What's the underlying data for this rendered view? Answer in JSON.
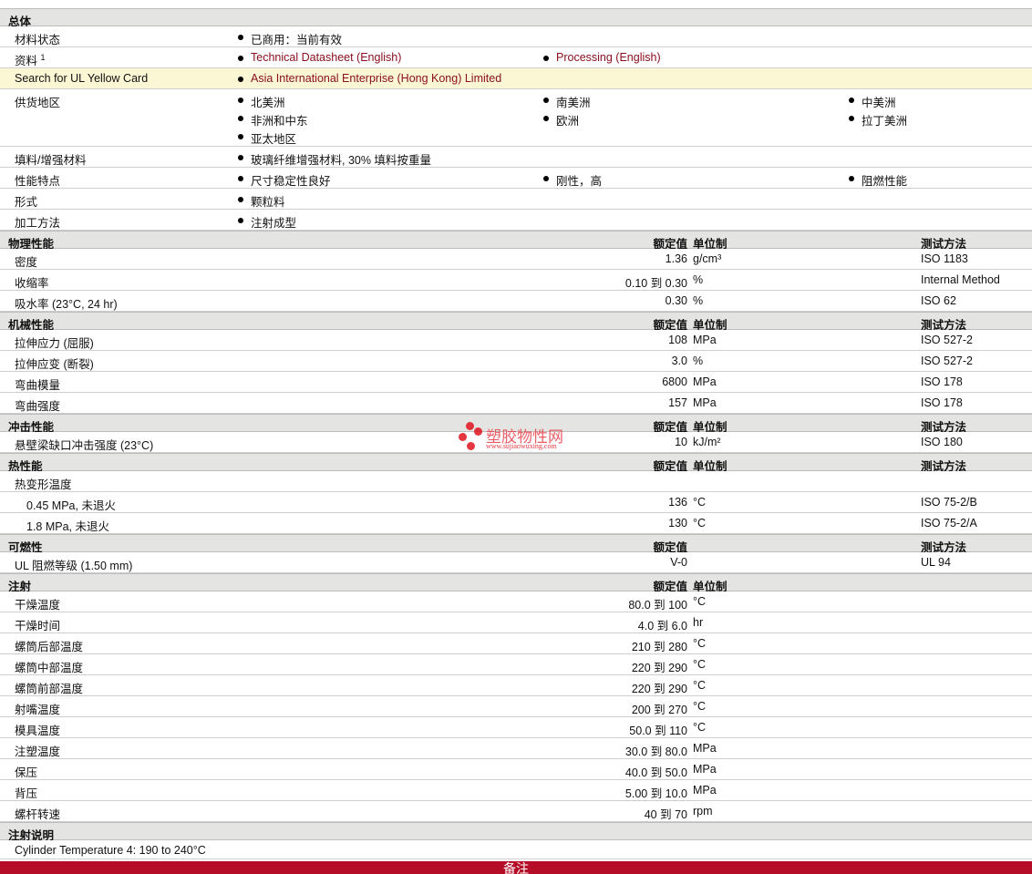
{
  "general": {
    "title": "总体",
    "rows": [
      {
        "label": "材料状态",
        "items": [
          {
            "text": "已商用：当前有效"
          }
        ]
      },
      {
        "label": "资料",
        "sup": "1",
        "items": [
          {
            "text": "Technical Datasheet (English)",
            "link": true
          },
          {
            "text": "Processing (English)",
            "link": true
          }
        ]
      },
      {
        "label": "Search for UL Yellow Card",
        "highlight": true,
        "items": [
          {
            "text": "Asia International Enterprise (Hong Kong) Limited",
            "link": true
          }
        ]
      },
      {
        "label": "供货地区",
        "items": [
          {
            "text": "北美洲"
          },
          {
            "text": "南美洲"
          },
          {
            "text": "中美洲"
          },
          {
            "text": "非洲和中东"
          },
          {
            "text": "欧洲"
          },
          {
            "text": "拉丁美洲"
          },
          {
            "text": "亚太地区"
          }
        ],
        "grid": true
      },
      {
        "label": "填料/增强材料",
        "items": [
          {
            "text": "玻璃纤维增强材料, 30% 填料按重量"
          }
        ]
      },
      {
        "label": "性能特点",
        "items": [
          {
            "text": "尺寸稳定性良好"
          },
          {
            "text": "刚性，高"
          },
          {
            "text": "阻燃性能"
          }
        ]
      },
      {
        "label": "形式",
        "items": [
          {
            "text": "颗粒料"
          }
        ]
      },
      {
        "label": "加工方法",
        "items": [
          {
            "text": "注射成型"
          }
        ]
      }
    ]
  },
  "sections": [
    {
      "title": "物理性能",
      "col_value": "额定值",
      "col_unit": "单位制",
      "col_test": "测试方法",
      "rows": [
        {
          "label": "密度",
          "value": "1.36",
          "unit": "g/cm³",
          "test": "ISO 1183"
        },
        {
          "label": "收缩率",
          "value": "0.10 到  0.30",
          "unit": "%",
          "test": "Internal Method"
        },
        {
          "label": "吸水率  (23°C, 24 hr)",
          "value": "0.30",
          "unit": "%",
          "test": "ISO 62"
        }
      ]
    },
    {
      "title": "机械性能",
      "col_value": "额定值",
      "col_unit": "单位制",
      "col_test": "测试方法",
      "rows": [
        {
          "label": "拉伸应力  (屈服)",
          "value": "108",
          "unit": "MPa",
          "test": "ISO 527-2"
        },
        {
          "label": "拉伸应变  (断裂)",
          "value": "3.0",
          "unit": "%",
          "test": "ISO 527-2"
        },
        {
          "label": "弯曲模量",
          "value": "6800",
          "unit": "MPa",
          "test": "ISO 178"
        },
        {
          "label": "弯曲强度",
          "value": "157",
          "unit": "MPa",
          "test": "ISO 178"
        }
      ]
    },
    {
      "title": "冲击性能",
      "col_value": "额定值",
      "col_unit": "单位制",
      "col_test": "测试方法",
      "rows": [
        {
          "label": "悬壁梁缺口冲击强度  (23°C)",
          "value": "10",
          "unit": "kJ/m²",
          "test": "ISO 180"
        }
      ]
    },
    {
      "title": "热性能",
      "col_value": "额定值",
      "col_unit": "单位制",
      "col_test": "测试方法",
      "rows": [
        {
          "label": "热变形温度"
        },
        {
          "label": "0.45 MPa, 未退火",
          "indent": true,
          "value": "136",
          "unit": "°C",
          "test": "ISO 75-2/B"
        },
        {
          "label": "1.8 MPa, 未退火",
          "indent": true,
          "value": "130",
          "unit": "°C",
          "test": "ISO 75-2/A"
        }
      ]
    },
    {
      "title": "可燃性",
      "col_value": "额定值",
      "col_test": "测试方法",
      "rows": [
        {
          "label": "UL 阻燃等级  (1.50 mm)",
          "value": "V-0",
          "test": "UL 94"
        }
      ]
    },
    {
      "title": "注射",
      "col_value": "额定值",
      "col_unit": "单位制",
      "rows": [
        {
          "label": "干燥温度",
          "value": "80.0 到  100",
          "unit": "°C"
        },
        {
          "label": "干燥时间",
          "value": "4.0 到  6.0",
          "unit": "hr"
        },
        {
          "label": "螺筒后部温度",
          "value": "210 到  280",
          "unit": "°C"
        },
        {
          "label": "螺筒中部温度",
          "value": "220 到  290",
          "unit": "°C"
        },
        {
          "label": "螺筒前部温度",
          "value": "220 到  290",
          "unit": "°C"
        },
        {
          "label": "射嘴温度",
          "value": "200 到  270",
          "unit": "°C"
        },
        {
          "label": "模具温度",
          "value": "50.0 到  110",
          "unit": "°C"
        },
        {
          "label": "注塑温度",
          "value": "30.0 到  80.0",
          "unit": "MPa"
        },
        {
          "label": "保压",
          "value": "40.0 到  50.0",
          "unit": "MPa"
        },
        {
          "label": "背压",
          "value": "5.00 到  10.0",
          "unit": "MPa"
        },
        {
          "label": "螺杆转速",
          "value": "40 到  70",
          "unit": "rpm"
        }
      ]
    },
    {
      "title": "注射说明",
      "rows": [
        {
          "label": "Cylinder Temperature 4: 190 to 240°C"
        }
      ]
    }
  ],
  "footer": {
    "label": "备注"
  },
  "watermark": {
    "name": "塑胶物性网",
    "url": "www.sujiaowuxing.com"
  },
  "colors": {
    "accent": "#b50d27",
    "link": "#8b1020",
    "section_bg": "#e4e4e2",
    "highlight": "#fbf6d4"
  }
}
